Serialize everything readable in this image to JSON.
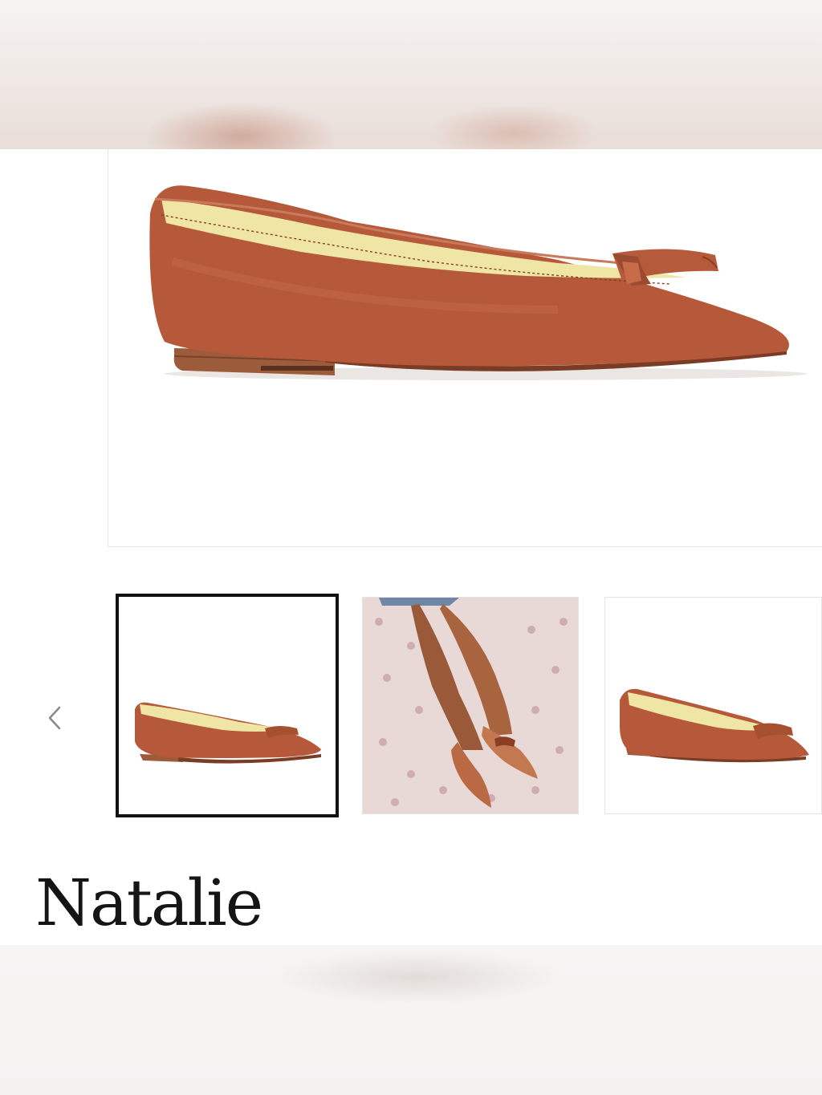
{
  "product": {
    "name": "Natalie"
  },
  "gallery": {
    "main_image": "side-view-brown-leather-pointed-flat-with-bow",
    "thumbnails": [
      {
        "image": "side-view-flat",
        "selected": true
      },
      {
        "image": "lifestyle-crossed-legs-on-tufted-chair",
        "selected": false
      },
      {
        "image": "angled-view-flat",
        "selected": false
      }
    ],
    "prev_icon": "chevron-left-icon"
  },
  "colors": {
    "leather": "#b5593a",
    "lining": "#efe6a5",
    "sole": "#9a5a3a",
    "selected_border": "#111111"
  }
}
